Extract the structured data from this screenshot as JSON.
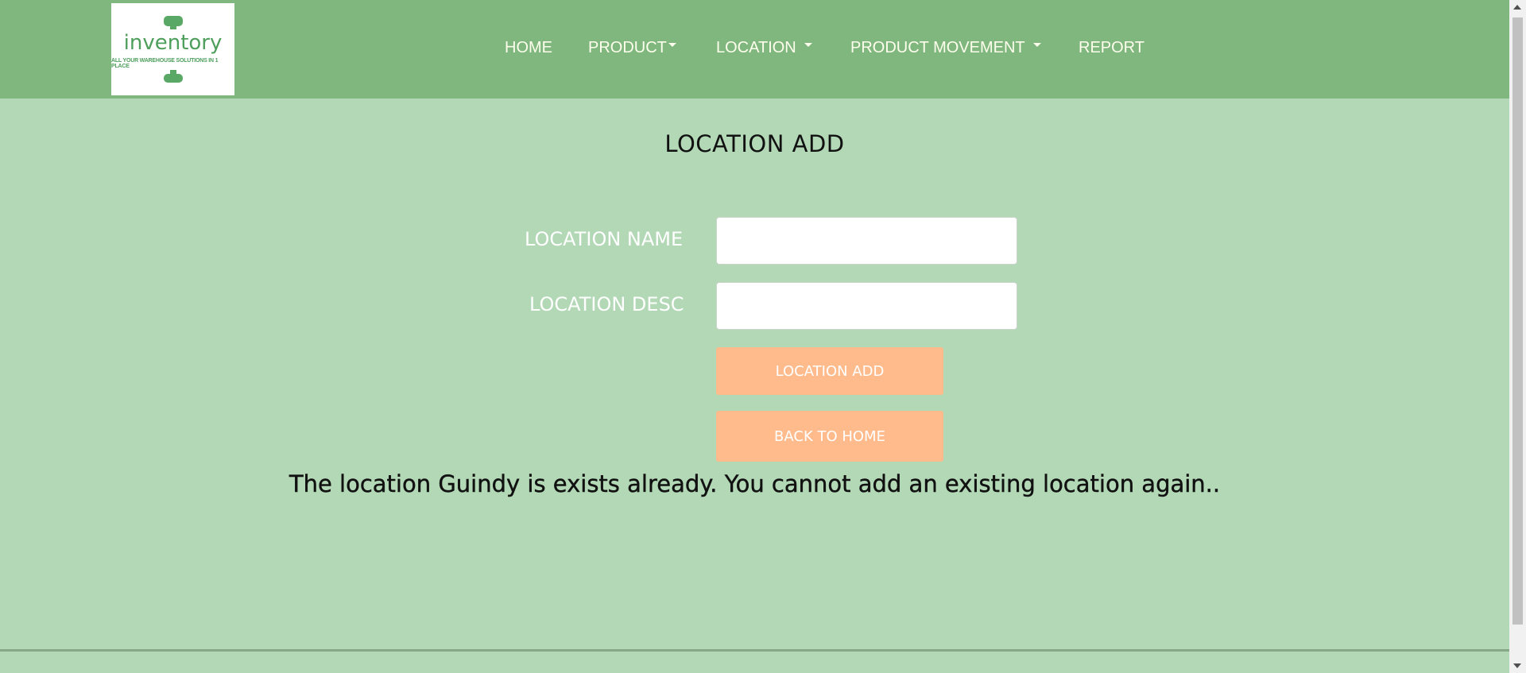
{
  "brand": {
    "logo_word": "inventory",
    "logo_tagline": "ALL YOUR WAREHOUSE SOLUTIONS IN 1 PLACE"
  },
  "nav": {
    "home": "HOME",
    "product": "PRODUCT",
    "location": "LOCATION",
    "product_movement": "PRODUCT MOVEMENT",
    "report": "REPORT"
  },
  "page": {
    "title": "LOCATION ADD"
  },
  "form": {
    "location_name_label": "LOCATION NAME",
    "location_name_value": "",
    "location_desc_label": "LOCATION DESC",
    "location_desc_value": "",
    "submit_label": "LOCATION ADD",
    "back_label": "BACK TO HOME"
  },
  "message": "The location Guindy is exists already. You cannot add an existing location again..",
  "colors": {
    "navbar": "#7fb77e",
    "background": "#b2d8b6",
    "button": "#ffbb8b",
    "nav_text": "#ffffee"
  }
}
